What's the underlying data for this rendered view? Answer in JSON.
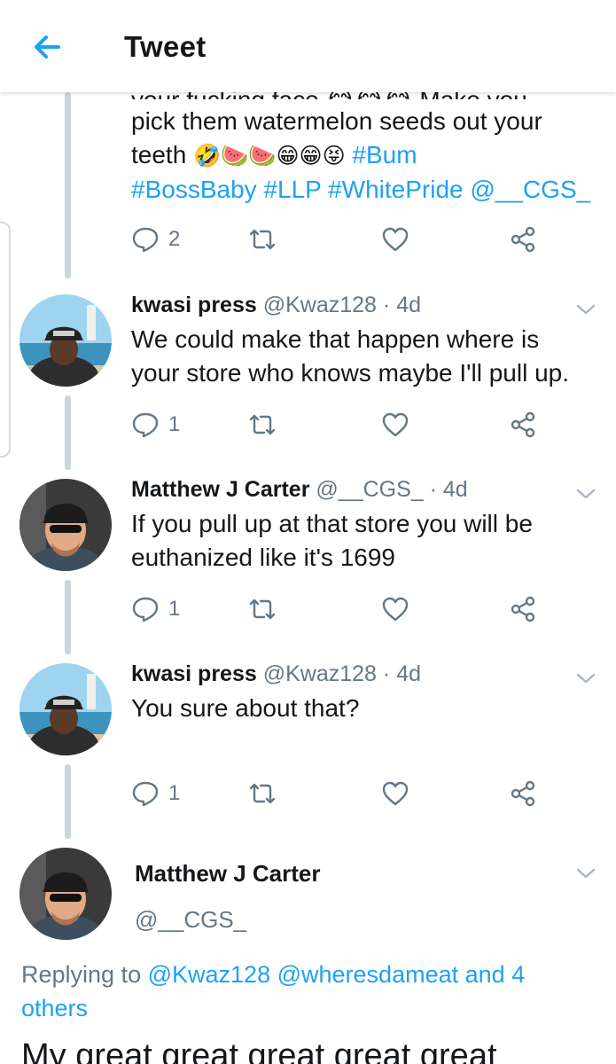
{
  "header": {
    "title": "Tweet"
  },
  "colors": {
    "accent": "#1da1f2",
    "muted": "#657786",
    "text": "#14171a",
    "thread": "#ccd6dd"
  },
  "main_tweet": {
    "cut_line": "your fucking face 😂😂😂 Make you",
    "text_line1": "pick them watermelon seeds out your",
    "text_line2_start": "teeth ",
    "text_line2_emoji": "🤣🍉🍉😁😁😝",
    "text_line2_tag": "#Bum",
    "hashtags": {
      "bossbaby": "#BossBaby",
      "llp": "#LLP",
      "whitepride": "#WhitePride",
      "mention": "@__CGS_"
    },
    "reply_count": "2"
  },
  "replies": [
    {
      "name": "kwasi press",
      "handle": "@Kwaz128",
      "sep": "·",
      "time": "4d",
      "line1": "We could make that happen where is",
      "line2": "your store who knows maybe I'll pull up.",
      "reply_count": "1"
    },
    {
      "name": "Matthew J Carter",
      "handle": "@__CGS_",
      "sep": "·",
      "time": "4d",
      "line1": "If you pull up at that store you will be",
      "line2": "euthanized like it's 1699",
      "reply_count": "1"
    },
    {
      "name": "kwasi press",
      "handle": "@Kwaz128",
      "sep": "·",
      "time": "4d",
      "line1": "You sure about that?",
      "line2": "",
      "reply_count": "1"
    }
  ],
  "focused": {
    "name": "Matthew J Carter",
    "handle": "@__CGS_",
    "replying_prefix": "Replying to",
    "replying_user1": "@Kwaz128",
    "replying_user2": "@wheresdameat",
    "replying_suffix": "and 4 others",
    "text_cut": "My great great great great great"
  },
  "icons": [
    "back-arrow-icon",
    "reply-icon",
    "retweet-icon",
    "like-icon",
    "share-icon",
    "chevron-down-icon"
  ]
}
